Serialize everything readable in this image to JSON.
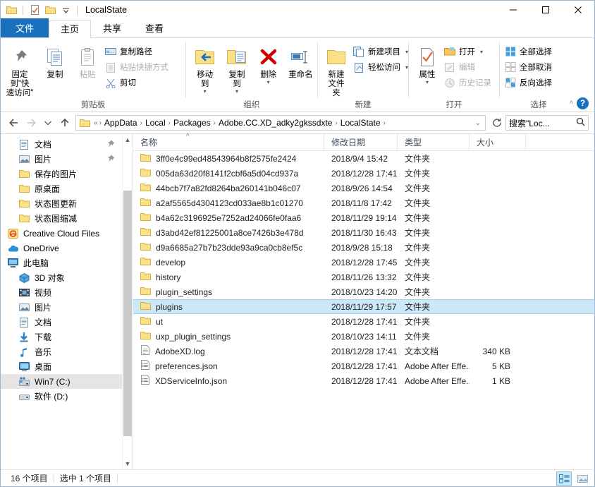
{
  "window": {
    "title": "LocalState",
    "quick_access": [
      "folder-icon",
      "properties-icon",
      "new-folder-icon",
      "customize-dropdown-icon"
    ],
    "controls": {
      "minimize": "minimize-icon",
      "maximize": "maximize-icon",
      "close": "close-icon"
    }
  },
  "ribbon": {
    "tabs": [
      {
        "label": "文件",
        "type": "file"
      },
      {
        "label": "主页",
        "type": "active"
      },
      {
        "label": "共享",
        "type": "normal"
      },
      {
        "label": "查看",
        "type": "normal"
      }
    ],
    "collapse_label": "^",
    "help_label": "?",
    "groups": [
      {
        "name": "剪贴板",
        "big": [
          {
            "label1": "固定到\"快",
            "label2": "速访问\"",
            "icon": "pin-icon",
            "enabled": true
          },
          {
            "label1": "复制",
            "label2": "",
            "icon": "copy-icon",
            "enabled": true
          },
          {
            "label1": "粘贴",
            "label2": "",
            "icon": "paste-icon",
            "enabled": false
          }
        ],
        "small": [
          {
            "label": "复制路径",
            "icon": "copy-path-icon",
            "enabled": true
          },
          {
            "label": "粘贴快捷方式",
            "icon": "paste-shortcut-icon",
            "enabled": false
          },
          {
            "label": "剪切",
            "icon": "cut-icon",
            "enabled": true
          }
        ]
      },
      {
        "name": "组织",
        "big": [
          {
            "label1": "移动到",
            "label2": "",
            "icon": "move-to-icon",
            "enabled": true,
            "caret": true
          },
          {
            "label1": "复制到",
            "label2": "",
            "icon": "copy-to-icon",
            "enabled": true,
            "caret": true
          },
          {
            "label1": "删除",
            "label2": "",
            "icon": "delete-icon",
            "enabled": true,
            "caret": true
          },
          {
            "label1": "重命名",
            "label2": "",
            "icon": "rename-icon",
            "enabled": true
          }
        ],
        "small": []
      },
      {
        "name": "新建",
        "big": [
          {
            "label1": "新建",
            "label2": "文件夹",
            "icon": "new-folder-icon",
            "enabled": true
          }
        ],
        "small": [
          {
            "label": "新建项目",
            "icon": "new-item-icon",
            "enabled": true,
            "caret": true
          },
          {
            "label": "轻松访问",
            "icon": "easy-access-icon",
            "enabled": true,
            "caret": true
          }
        ]
      },
      {
        "name": "打开",
        "big": [
          {
            "label1": "属性",
            "label2": "",
            "icon": "properties-icon",
            "enabled": true,
            "caret": true
          }
        ],
        "small": [
          {
            "label": "打开",
            "icon": "open-icon",
            "enabled": true,
            "caret": true
          },
          {
            "label": "编辑",
            "icon": "edit-icon",
            "enabled": false
          },
          {
            "label": "历史记录",
            "icon": "history-icon",
            "enabled": false
          }
        ]
      },
      {
        "name": "选择",
        "big": [],
        "small": [
          {
            "label": "全部选择",
            "icon": "select-all-icon",
            "enabled": true
          },
          {
            "label": "全部取消",
            "icon": "select-none-icon",
            "enabled": true
          },
          {
            "label": "反向选择",
            "icon": "invert-selection-icon",
            "enabled": true
          }
        ]
      }
    ]
  },
  "address": {
    "back_icon": "back-arrow-icon",
    "forward_icon": "forward-arrow-icon",
    "recent_icon": "recent-locations-icon",
    "up_icon": "up-arrow-icon",
    "overflow": "«",
    "crumbs": [
      "AppData",
      "Local",
      "Packages",
      "Adobe.CC.XD_adky2gkssdxte",
      "LocalState"
    ],
    "dropdown_icon": "chevron-down-icon",
    "refresh_icon": "refresh-icon",
    "search_placeholder": "搜索\"Loc...",
    "search_icon": "search-icon"
  },
  "sidebar": {
    "items": [
      {
        "label": "文档",
        "icon": "documents-icon",
        "indent": 1,
        "pinned": true
      },
      {
        "label": "图片",
        "icon": "pictures-icon",
        "indent": 1,
        "pinned": true
      },
      {
        "label": "保存的图片",
        "icon": "folder-icon",
        "indent": 1,
        "pinned": false
      },
      {
        "label": "原桌面",
        "icon": "folder-icon",
        "indent": 1,
        "pinned": false
      },
      {
        "label": "状态图更新",
        "icon": "folder-icon",
        "indent": 1,
        "pinned": false
      },
      {
        "label": "状态图缩减",
        "icon": "folder-icon",
        "indent": 1,
        "pinned": false
      },
      {
        "label": "Creative Cloud Files",
        "icon": "creative-cloud-icon",
        "indent": 0,
        "pinned": false
      },
      {
        "label": "OneDrive",
        "icon": "onedrive-icon",
        "indent": 0,
        "pinned": false
      },
      {
        "label": "此电脑",
        "icon": "this-pc-icon",
        "indent": 0,
        "pinned": false
      },
      {
        "label": "3D 对象",
        "icon": "3d-objects-icon",
        "indent": 1,
        "pinned": false
      },
      {
        "label": "视频",
        "icon": "videos-icon",
        "indent": 1,
        "pinned": false
      },
      {
        "label": "图片",
        "icon": "pictures-icon",
        "indent": 1,
        "pinned": false
      },
      {
        "label": "文档",
        "icon": "documents-icon",
        "indent": 1,
        "pinned": false
      },
      {
        "label": "下载",
        "icon": "downloads-icon",
        "indent": 1,
        "pinned": false
      },
      {
        "label": "音乐",
        "icon": "music-icon",
        "indent": 1,
        "pinned": false
      },
      {
        "label": "桌面",
        "icon": "desktop-icon",
        "indent": 1,
        "pinned": false
      },
      {
        "label": "Win7 (C:)",
        "icon": "system-drive-icon",
        "indent": 1,
        "pinned": false,
        "selected": true
      },
      {
        "label": "软件 (D:)",
        "icon": "drive-icon",
        "indent": 1,
        "pinned": false
      }
    ]
  },
  "filelist": {
    "columns": [
      "名称",
      "修改日期",
      "类型",
      "大小"
    ],
    "sorted_column": "名称",
    "rows": [
      {
        "name": "3ff0e4c99ed48543964b8f2575fe2424",
        "date": "2018/9/4 15:42",
        "type": "文件夹",
        "size": "",
        "icon": "folder-icon",
        "selected": false
      },
      {
        "name": "005da63d20f8141f2cbf6a5d04cd937a",
        "date": "2018/12/28 17:41",
        "type": "文件夹",
        "size": "",
        "icon": "folder-icon",
        "selected": false
      },
      {
        "name": "44bcb7f7a82fd8264ba260141b046c07",
        "date": "2018/9/26 14:54",
        "type": "文件夹",
        "size": "",
        "icon": "folder-icon",
        "selected": false
      },
      {
        "name": "a2af5565d4304123cd033ae8b1c01270",
        "date": "2018/11/8 17:42",
        "type": "文件夹",
        "size": "",
        "icon": "folder-icon",
        "selected": false
      },
      {
        "name": "b4a62c3196925e7252ad24066fe0faa6",
        "date": "2018/11/29 19:14",
        "type": "文件夹",
        "size": "",
        "icon": "folder-icon",
        "selected": false
      },
      {
        "name": "d3abd42ef81225001a8ce7426b3e478d",
        "date": "2018/11/30 16:43",
        "type": "文件夹",
        "size": "",
        "icon": "folder-icon",
        "selected": false
      },
      {
        "name": "d9a6685a27b7b23dde93a9ca0cb8ef5c",
        "date": "2018/9/28 15:18",
        "type": "文件夹",
        "size": "",
        "icon": "folder-icon",
        "selected": false
      },
      {
        "name": "develop",
        "date": "2018/12/28 17:45",
        "type": "文件夹",
        "size": "",
        "icon": "folder-icon",
        "selected": false
      },
      {
        "name": "history",
        "date": "2018/11/26 13:32",
        "type": "文件夹",
        "size": "",
        "icon": "folder-icon",
        "selected": false
      },
      {
        "name": "plugin_settings",
        "date": "2018/10/23 14:20",
        "type": "文件夹",
        "size": "",
        "icon": "folder-icon",
        "selected": false
      },
      {
        "name": "plugins",
        "date": "2018/11/29 17:57",
        "type": "文件夹",
        "size": "",
        "icon": "folder-icon",
        "selected": true
      },
      {
        "name": "ut",
        "date": "2018/12/28 17:41",
        "type": "文件夹",
        "size": "",
        "icon": "folder-icon",
        "selected": false
      },
      {
        "name": "uxp_plugin_settings",
        "date": "2018/10/23 14:11",
        "type": "文件夹",
        "size": "",
        "icon": "folder-icon",
        "selected": false
      },
      {
        "name": "AdobeXD.log",
        "date": "2018/12/28 17:41",
        "type": "文本文档",
        "size": "340 KB",
        "icon": "text-file-icon",
        "selected": false
      },
      {
        "name": "preferences.json",
        "date": "2018/12/28 17:41",
        "type": "Adobe After Effe...",
        "size": "5 KB",
        "icon": "json-file-icon",
        "selected": false
      },
      {
        "name": "XDServiceInfo.json",
        "date": "2018/12/28 17:41",
        "type": "Adobe After Effe...",
        "size": "1 KB",
        "icon": "json-file-icon",
        "selected": false
      }
    ]
  },
  "status": {
    "item_count": "16 个项目",
    "selection": "选中 1 个项目",
    "details_view_icon": "details-view-icon",
    "tiles_view_icon": "large-icons-view-icon"
  },
  "colors": {
    "accent": "#1b70bd",
    "selection": "#cce8f7",
    "folder": "#fbe08a"
  }
}
